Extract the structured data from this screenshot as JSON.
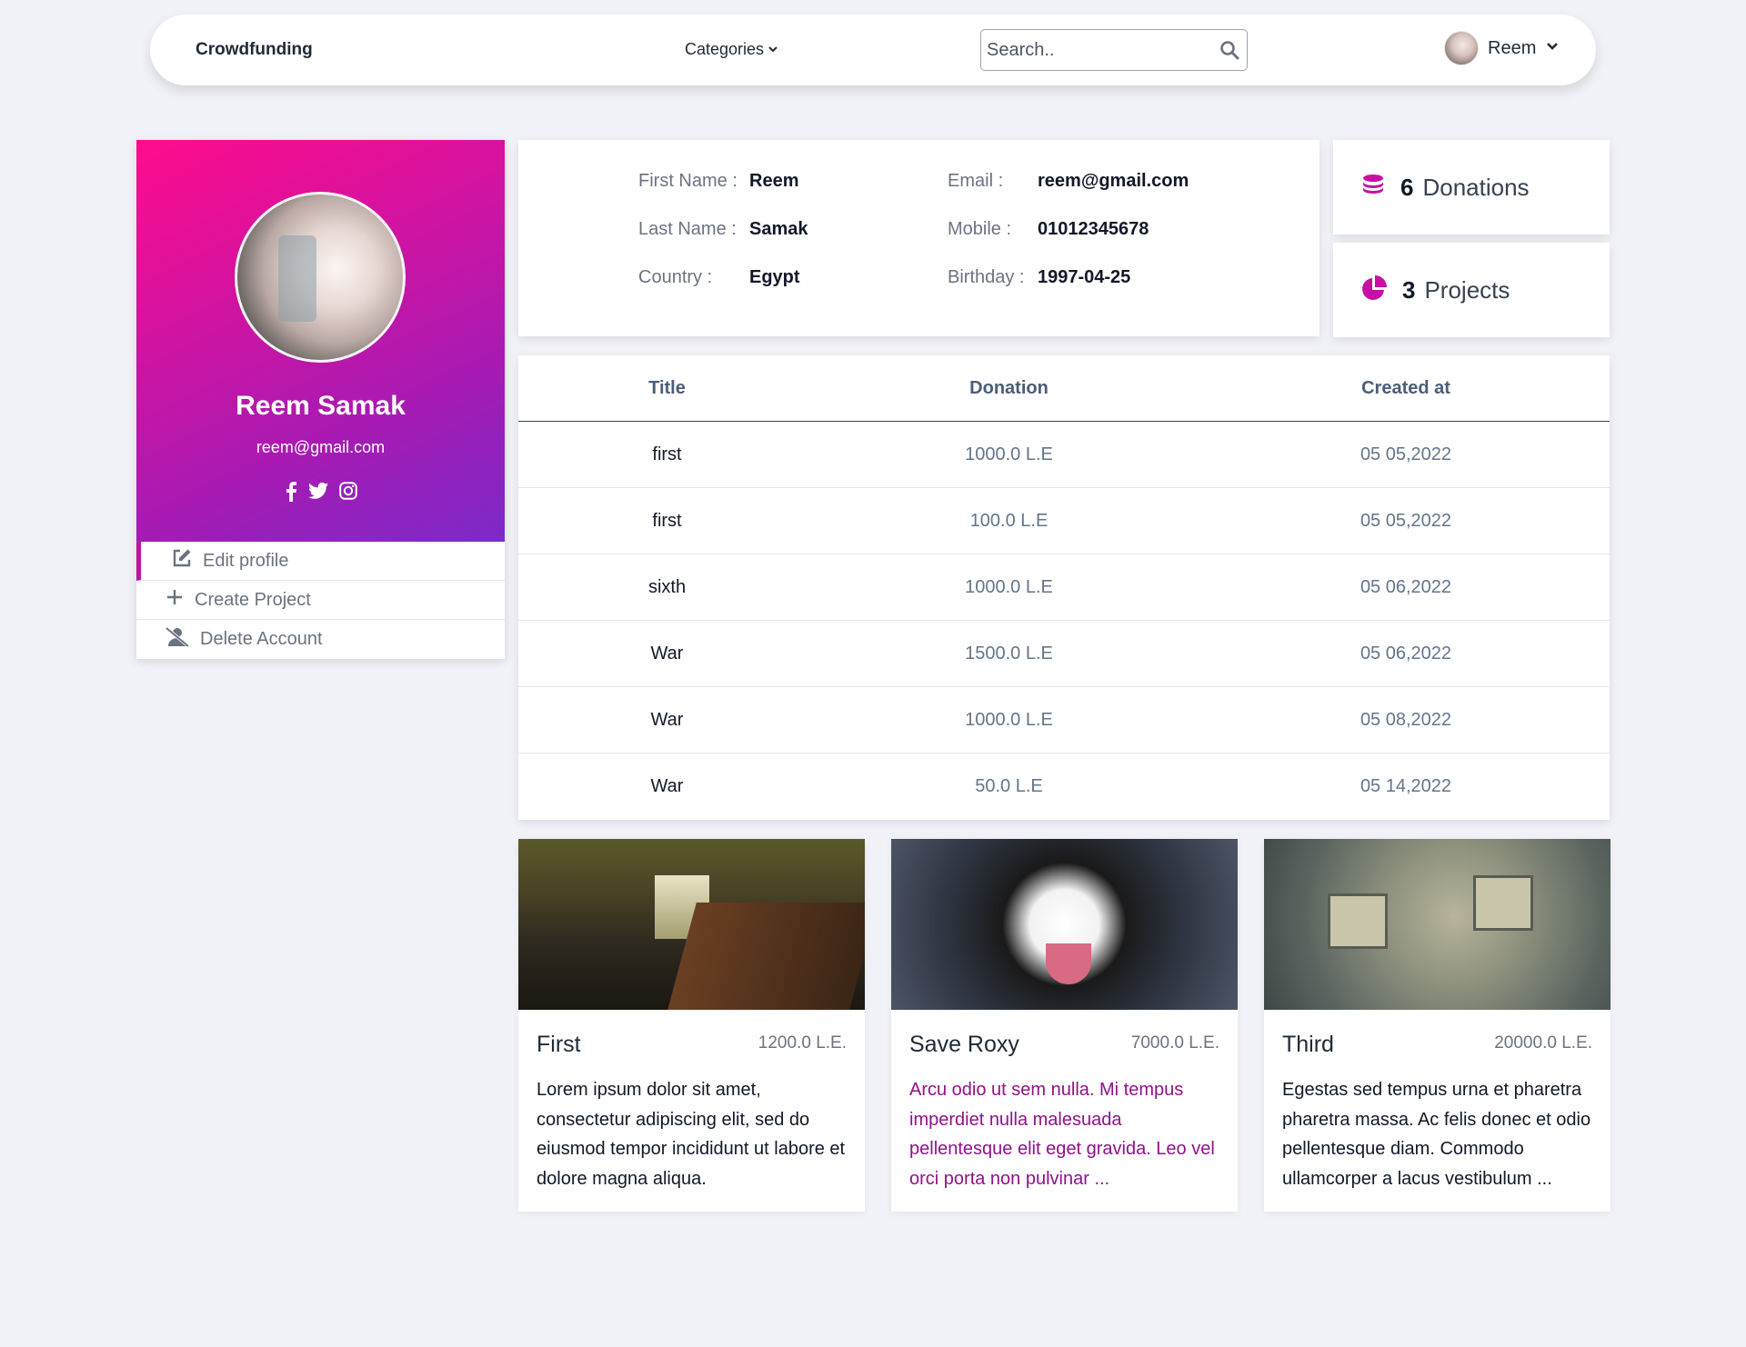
{
  "navbar": {
    "brand": "Crowdfunding",
    "categories_label": "Categories",
    "search_placeholder": "Search..",
    "user_name": "Reem"
  },
  "profile": {
    "name": "Reem Samak",
    "email": "reem@gmail.com",
    "socials": [
      "facebook-icon",
      "twitter-icon",
      "instagram-icon"
    ],
    "menu": [
      {
        "label": "Edit profile",
        "icon": "edit-icon"
      },
      {
        "label": "Create Project",
        "icon": "plus-icon"
      },
      {
        "label": "Delete Account",
        "icon": "user-slash-icon"
      }
    ]
  },
  "info": {
    "first_name_label": "First Name :",
    "first_name": "Reem",
    "last_name_label": "Last Name :",
    "last_name": "Samak",
    "country_label": "Country :",
    "country": "Egypt",
    "email_label": "Email :",
    "email": "reem@gmail.com",
    "mobile_label": "Mobile :",
    "mobile": "01012345678",
    "birthday_label": "Birthday :",
    "birthday": "1997-04-25"
  },
  "stats": {
    "donations_count": "6",
    "donations_label": "Donations",
    "projects_count": "3",
    "projects_label": "Projects"
  },
  "table": {
    "headers": [
      "Title",
      "Donation",
      "Created at"
    ],
    "rows": [
      [
        "first",
        "1000.0 L.E",
        "05 05,2022"
      ],
      [
        "first",
        "100.0 L.E",
        "05 05,2022"
      ],
      [
        "sixth",
        "1000.0 L.E",
        "05 06,2022"
      ],
      [
        "War",
        "1500.0 L.E",
        "05 06,2022"
      ],
      [
        "War",
        "1000.0 L.E",
        "05 08,2022"
      ],
      [
        "War",
        "50.0 L.E",
        "05 14,2022"
      ]
    ]
  },
  "projects": [
    {
      "title": "First",
      "amount": "1200.0 L.E.",
      "description": "Lorem ipsum dolor sit amet, consectetur adipiscing elit, sed do eiusmod tempor incididunt ut labore et dolore magna aliqua."
    },
    {
      "title": "Save Roxy",
      "amount": "7000.0 L.E.",
      "description": "Arcu odio ut sem nulla. Mi tempus imperdiet nulla malesuada pellentesque elit eget gravida. Leo vel orci porta non pulvinar ..."
    },
    {
      "title": "Third",
      "amount": "20000.0 L.E.",
      "description": "Egestas sed tempus urna et pharetra pharetra massa. Ac felis donec et odio pellentesque diam. Commodo ullamcorper a lacus vestibulum ..."
    }
  ],
  "colors": {
    "accent": "#c510a3",
    "gradient_start": "#ff0c8c",
    "gradient_end": "#7b2ac9",
    "background": "#f1f2f7"
  }
}
